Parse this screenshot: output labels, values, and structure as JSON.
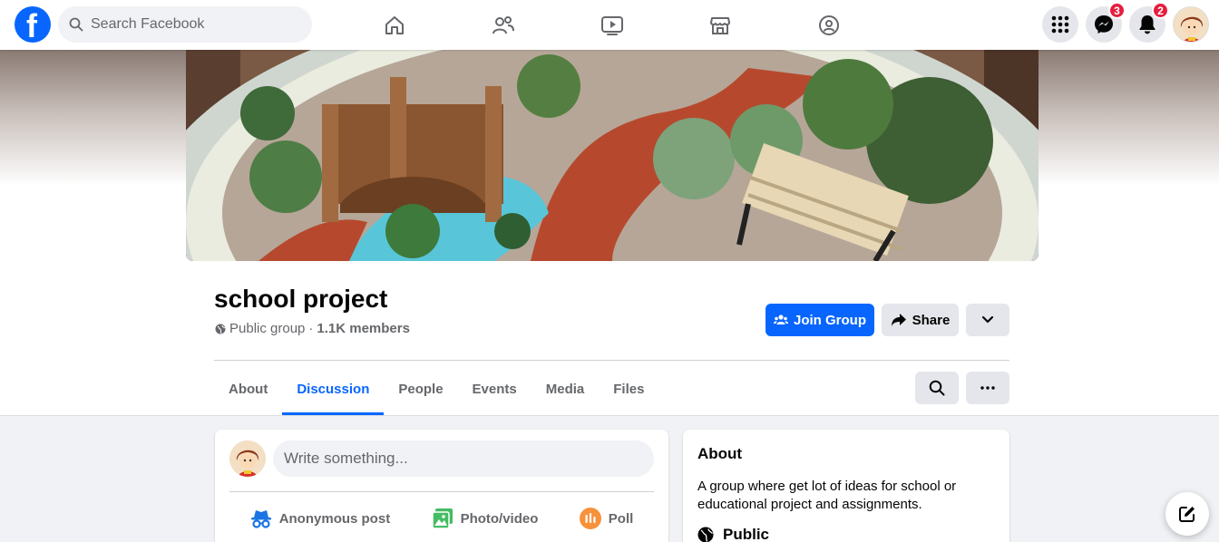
{
  "topnav": {
    "logo_letter": "f",
    "search_placeholder": "Search Facebook",
    "messenger_badge": "3",
    "notifications_badge": "2"
  },
  "group": {
    "title": "school project",
    "privacy": "Public group",
    "separator": "·",
    "members": "1.1K members"
  },
  "actions": {
    "join_label": "Join Group",
    "share_label": "Share"
  },
  "tabs": [
    "About",
    "Discussion",
    "People",
    "Events",
    "Media",
    "Files"
  ],
  "active_tab": "Discussion",
  "composer": {
    "placeholder": "Write something...",
    "anonymous_label": "Anonymous post",
    "photo_label": "Photo/video",
    "poll_label": "Poll"
  },
  "about": {
    "heading": "About",
    "description": "A group where get lot of ideas for school or educational project and assignments.",
    "privacy_label": "Public"
  },
  "colors": {
    "accent": "#0866ff",
    "badge": "#e41e3f"
  }
}
